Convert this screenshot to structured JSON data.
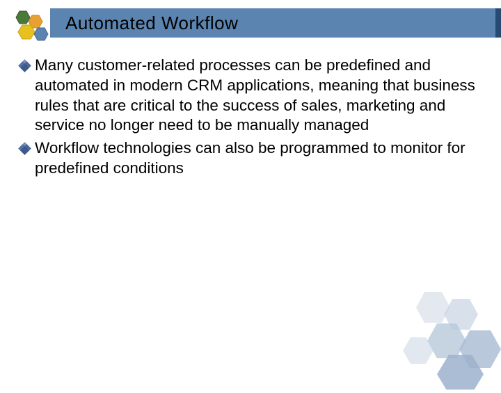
{
  "slide": {
    "title": "Automated Workflow",
    "bullets": [
      "Many customer-related processes can be predefined and automated in modern CRM applications, meaning that business rules that are critical to the success of sales, marketing and service no longer need to be manually managed",
      "Workflow technologies can also be programmed to monitor for predefined conditions"
    ]
  }
}
